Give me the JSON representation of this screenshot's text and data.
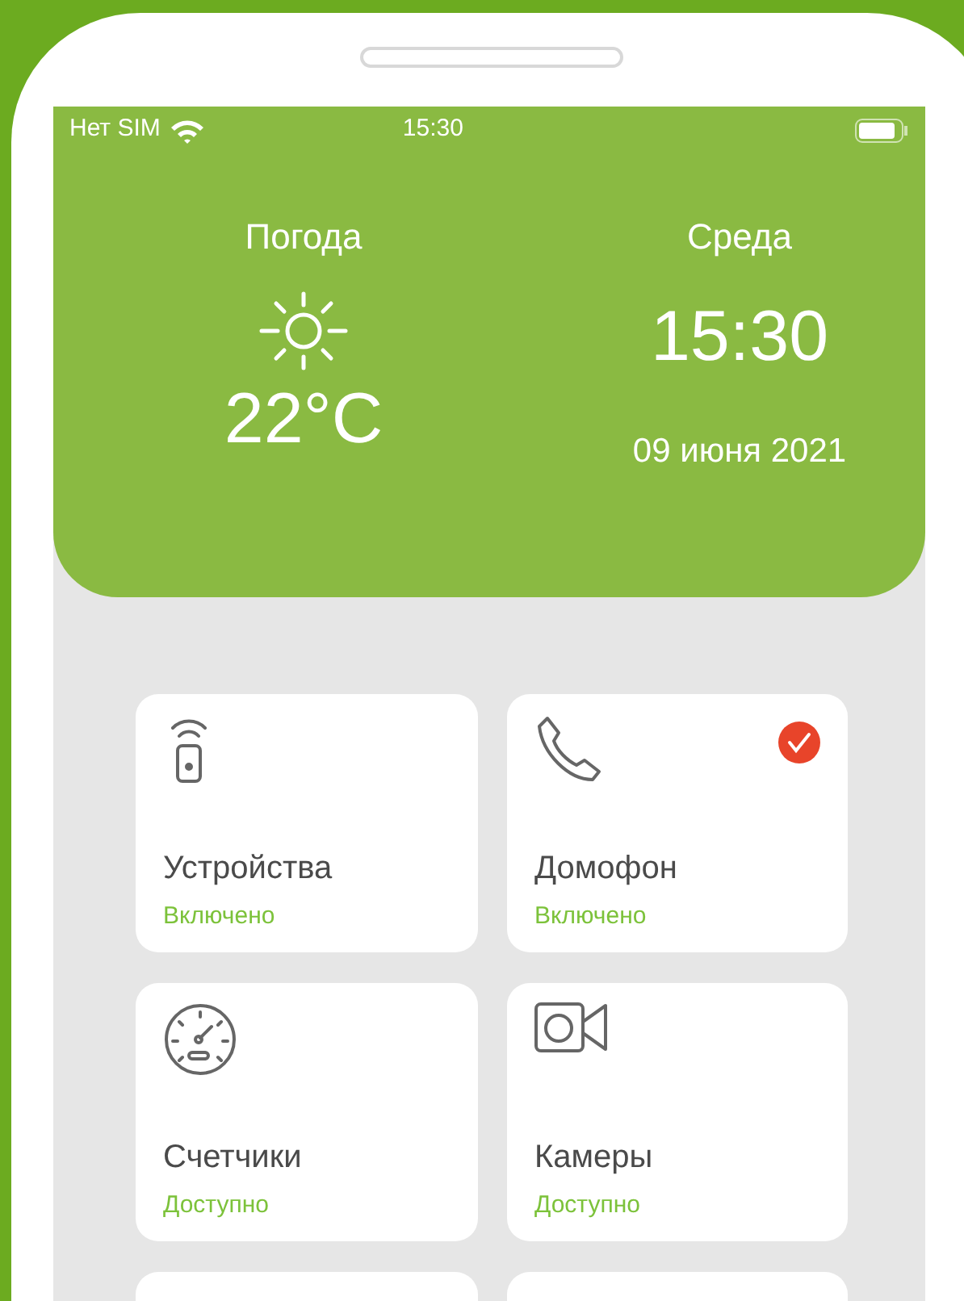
{
  "status_bar": {
    "carrier": "Нет SIM",
    "time": "15:30"
  },
  "weather": {
    "label": "Погода",
    "temperature": "22°C"
  },
  "clock": {
    "weekday": "Среда",
    "time": "15:30",
    "date": "09 июня 2021"
  },
  "tiles": [
    {
      "kind": "remote",
      "title": "Устройства",
      "status": "Включено",
      "checked": false
    },
    {
      "kind": "phone",
      "title": "Домофон",
      "status": "Включено",
      "checked": true
    },
    {
      "kind": "gauge",
      "title": "Счетчики",
      "status": "Доступно",
      "checked": false
    },
    {
      "kind": "camera",
      "title": "Камеры",
      "status": "Доступно",
      "checked": false
    }
  ]
}
